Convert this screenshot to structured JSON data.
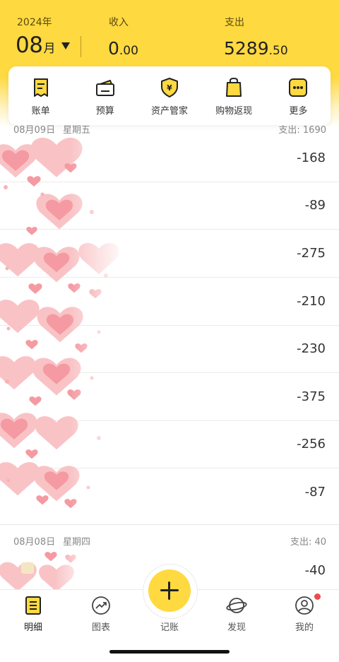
{
  "header": {
    "year": "2024年",
    "month_num": "08",
    "month_unit": "月",
    "income_label": "收入",
    "income_int": "0",
    "income_dec": ".00",
    "expense_label": "支出",
    "expense_int": "5289",
    "expense_dec": ".50"
  },
  "quick_actions": [
    {
      "label": "账单",
      "icon": "bill-icon"
    },
    {
      "label": "预算",
      "icon": "wallet-icon"
    },
    {
      "label": "资产管家",
      "icon": "asset-shield-icon"
    },
    {
      "label": "购物返现",
      "icon": "shopping-bag-icon"
    },
    {
      "label": "更多",
      "icon": "more-icon"
    }
  ],
  "groups": [
    {
      "date": "08月09日",
      "weekday": "星期五",
      "total": "支出: 1690",
      "amounts": [
        "-168",
        "-89",
        "-275",
        "-210",
        "-230",
        "-375",
        "-256",
        "-87"
      ]
    },
    {
      "date": "08月08日",
      "weekday": "星期四",
      "total": "支出: 40",
      "amounts": [
        "-40"
      ]
    }
  ],
  "nav": {
    "items": [
      {
        "label": "明细",
        "icon": "detail-icon"
      },
      {
        "label": "图表",
        "icon": "chart-icon"
      },
      {
        "label": "记账",
        "icon": "plus-icon"
      },
      {
        "label": "发现",
        "icon": "planet-icon"
      },
      {
        "label": "我的",
        "icon": "profile-icon"
      }
    ]
  },
  "colors": {
    "brand_yellow": "#ffd940",
    "badge_red": "#f04b4b",
    "heart_pink": "#f7a1a7"
  }
}
